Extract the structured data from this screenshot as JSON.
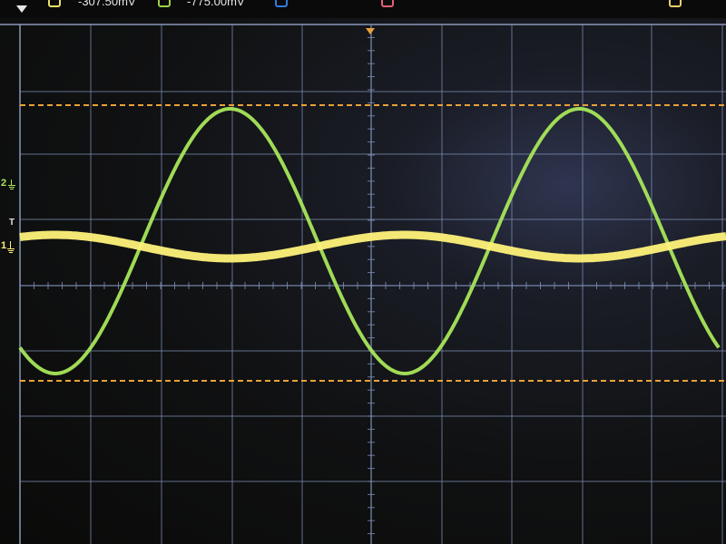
{
  "top_bar": {
    "channels": [
      {
        "value": "-307.50mV",
        "color": "#e8e26a"
      },
      {
        "value": "-775.00mV",
        "color": "#9ad24a"
      }
    ],
    "extra_swatches": [
      {
        "color": "#2f7ee0"
      },
      {
        "color": "#e0607a"
      },
      {
        "color": "#e8d06a"
      }
    ],
    "menu_icon": "triangle-down-icon"
  },
  "markers": {
    "channel_2": "2",
    "trigger": "T",
    "channel_1": "1"
  },
  "colors": {
    "grid": "#7f90b8",
    "cursor": "#e9a13a",
    "trigger_marker": "#e9a13a",
    "channel_1_trace": "#fff27a",
    "channel_2_trace": "#a8e65a"
  },
  "screen": {
    "horizontal_divisions": 10,
    "vertical_divisions": 8,
    "cursors_visible": 2
  }
}
